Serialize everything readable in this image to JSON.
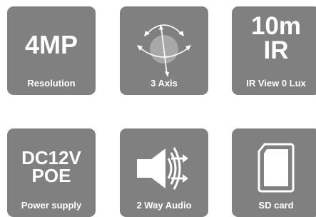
{
  "features": [
    {
      "big": "4MP",
      "caption": "Resolution"
    },
    {
      "icon": "rotation-axes-icon",
      "caption": "3 Axis"
    },
    {
      "big_line1": "10m",
      "big_line2": "IR",
      "caption": "IR View 0 Lux"
    },
    {
      "big_line1": "DC12V",
      "big_line2": "POE",
      "caption": "Power supply"
    },
    {
      "icon": "speaker-audio-icon",
      "caption": "2 Way Audio"
    },
    {
      "icon": "sd-card-icon",
      "caption": "SD card"
    }
  ],
  "colors": {
    "tile": "#808080",
    "text": "#ffffff",
    "background": "#ffffff"
  }
}
